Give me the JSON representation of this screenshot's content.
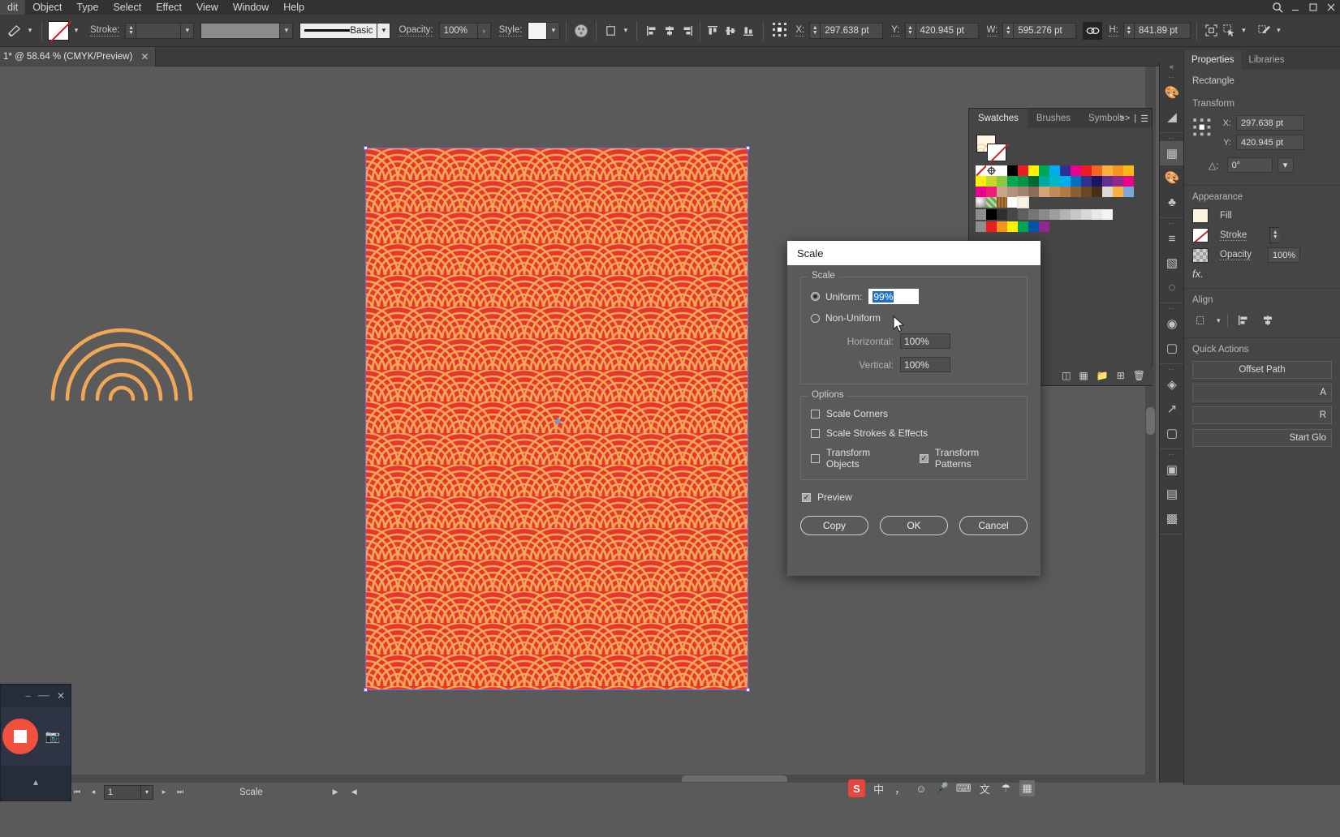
{
  "menubar": {
    "items": [
      "dit",
      "Object",
      "Type",
      "Select",
      "Effect",
      "View",
      "Window",
      "Help"
    ],
    "search_icon": "search-icon",
    "right_icons": [
      "minimize-icon",
      "maximize-icon",
      "close-icon"
    ]
  },
  "controlbar": {
    "tool_icon": "shape-tool-icon",
    "fill_swatch_icon": "no-fill-swatch",
    "stroke_label": "Stroke:",
    "stroke_weight_value": "",
    "stroke_profile_value": "",
    "brush_label_value": "Basic",
    "opacity_label": "Opacity:",
    "opacity_value": "100%",
    "style_label": "Style:",
    "style_swatch": "graphic-style-swatch",
    "recolor_icon": "recolor-artwork-icon",
    "artboard_icon": "artboard-tool-icon",
    "align_icons": [
      "align-left-icon",
      "align-center-h-icon",
      "align-right-icon",
      "align-top-icon",
      "align-middle-v-icon",
      "align-bottom-icon"
    ],
    "reference_point_icon": "reference-point-selector",
    "x_label": "X:",
    "x_value": "297.638 pt",
    "y_label": "Y:",
    "y_value": "420.945 pt",
    "w_label": "W:",
    "w_value": "595.276 pt",
    "link_icon": "constrain-proportions-link",
    "h_label": "H:",
    "h_value": "841.89 pt",
    "transform_icons": [
      "shape-transform-icon",
      "select-similar-icon",
      "isolate-icon"
    ]
  },
  "document_tab": {
    "title": "1* @ 58.64 % (CMYK/Preview)",
    "close_icon": "close-tab-icon"
  },
  "statusbar": {
    "first_icon": "first-page-icon",
    "prev_icon": "previous-page-icon",
    "page_value": "1",
    "page_arrow_icon": "chevron-down-icon",
    "next_icon": "next-page-icon",
    "last_icon": "last-page-icon",
    "tool_name": "Scale",
    "play_icon": "play-arrow-icon",
    "back_icon": "back-arrow-icon"
  },
  "swatches_panel": {
    "tabs": [
      "Swatches",
      "Brushes",
      "Symbols"
    ],
    "active_tab": "Swatches",
    "expand_icon": ">>",
    "divider": "|",
    "menu_icon": "panel-menu-icon",
    "view_list_icon": "list-view-icon",
    "view_grid_icon": "grid-view-icon",
    "fill_swatch": "pattern-fill-swatch",
    "stroke_swatch": "no-stroke-swatch",
    "rows": [
      [
        "none",
        "registration",
        "#ffffff",
        "#000000",
        "#ed1c24",
        "#fff200",
        "#00a651",
        "#00aeef",
        "#2e3192",
        "#ec008c",
        "#ed1c24",
        "#f26522"
      ],
      [
        "#fff200",
        "#c4d82e",
        "#8dc63f",
        "#00a651",
        "#009444",
        "#006838",
        "#00a99d",
        "#00aeef",
        "#0072bc",
        "#2e3192",
        "#1b1464",
        "#662d91"
      ],
      [
        "#ec008c",
        "#ed1e79",
        "#c8a48a",
        "#b5907a",
        "#a3836e",
        "#8c6e57",
        "#d4a373",
        "#c48b5a",
        "#b07a43",
        "#8a5f34",
        "#6b4723",
        "#4a2f17"
      ],
      [
        "globe",
        "#7ab648",
        "#8b5a2b",
        "#ffffff",
        "pattern-selected",
        "",
        "",
        "",
        "",
        "",
        "",
        ""
      ],
      [
        "folder",
        "#000000",
        "#3a3a3a",
        "#4d4d4d",
        "#616161",
        "#757575",
        "#8a8a8a",
        "#9e9e9e",
        "#b3b3b3",
        "#c7c7c7",
        "#dcdcdc",
        "#f0f0f0"
      ],
      [
        "folder",
        "#ed1c24",
        "#f7941e",
        "#fff200",
        "#00a651",
        "#0054a6",
        "#92278f",
        "",
        "",
        "",
        "",
        ""
      ]
    ],
    "bottom_icons": [
      "swatch-libraries-icon",
      "show-swatch-kinds-icon",
      "new-color-group-icon",
      "new-swatch-icon",
      "delete-swatch-icon"
    ]
  },
  "icon_rail": {
    "collapse_icon": "collapse-panels-icon",
    "groups": [
      [
        "color-panel-icon",
        "color-guide-icon"
      ],
      [
        "properties-panel-icon",
        "brushes-panel-icon",
        "symbols-panel-icon"
      ],
      [
        "align-panel-icon",
        "gradient-panel-icon",
        "transparency-panel-icon"
      ],
      [
        "appearance-panel-icon",
        "pathfinder-panel-icon"
      ],
      [
        "layers-panel-icon",
        "asset-export-icon",
        "artboards-panel-icon"
      ],
      [
        "transform-panel-icon",
        "align-panel2-icon",
        "pathfinder2-icon"
      ]
    ]
  },
  "properties_panel": {
    "tabs": [
      "Properties",
      "Libraries"
    ],
    "active_tab": "Properties",
    "object_type": "Rectangle",
    "transform": {
      "heading": "Transform",
      "reference_point_icon": "reference-point-selector",
      "x_label": "X:",
      "x_value": "297.638 pt",
      "y_label": "Y:",
      "y_value": "420.945 pt",
      "angle_icon": "shear-angle-icon",
      "angle_value": "0°",
      "angle_arrow_icon": "chevron-down-icon"
    },
    "appearance": {
      "heading": "Appearance",
      "fill_label": "Fill",
      "fill_swatch_icon": "pattern-fill-swatch",
      "stroke_label": "Stroke",
      "stroke_swatch_icon": "no-stroke-swatch",
      "stroke_value": "",
      "opacity_label": "Opacity",
      "opacity_swatch_icon": "transparency-grid-icon",
      "opacity_value": "100%",
      "fx_label": "fx."
    },
    "align": {
      "heading": "Align",
      "align_to_icon": "align-to-selection-icon",
      "icons": [
        "align-left-icon",
        "align-center-h-icon"
      ]
    },
    "quick_actions": {
      "heading": "Quick Actions",
      "buttons": [
        "Offset Path",
        "A",
        "R",
        "Start Glo"
      ]
    }
  },
  "scale_dialog": {
    "title": "Scale",
    "scale_group_label": "Scale",
    "uniform_label": "Uniform:",
    "uniform_value": "99%",
    "uniform_selected": true,
    "non_uniform_label": "Non-Uniform",
    "horizontal_label": "Horizontal:",
    "horizontal_value": "100%",
    "vertical_label": "Vertical:",
    "vertical_value": "100%",
    "options_group_label": "Options",
    "options": [
      {
        "label": "Scale Corners",
        "checked": false
      },
      {
        "label": "Scale Strokes & Effects",
        "checked": false
      },
      {
        "label": "Transform Objects",
        "checked": false
      },
      {
        "label": "Transform Patterns",
        "checked": true
      }
    ],
    "preview_label": "Preview",
    "preview_checked": true,
    "buttons": [
      "Copy",
      "OK",
      "Cancel"
    ],
    "cursor_icon": "mouse-pointer-cursor"
  },
  "recorder": {
    "minimize_icon": "minimize-icon",
    "restore_icon": "restore-icon",
    "close_icon": "close-icon",
    "record_button_icon": "stop-recording-button",
    "screenshot_icon": "camera-icon",
    "expand_icon": "chevron-up-icon"
  },
  "tray": {
    "ime_icon": "sogou-ime-icon",
    "icons": [
      "chinese-mode-icon",
      "punctuation-icon",
      "emoji-icon",
      "voice-input-icon",
      "keyboard-icon",
      "translate-icon",
      "toolbox-icon",
      "apps-icon"
    ],
    "labels": [
      "中",
      "，",
      "☺",
      "🎤",
      "⌨",
      "文",
      "☂",
      "▦"
    ]
  },
  "canvas": {
    "artboard_fill": "#e8362e",
    "pattern_stroke": "#f0a857",
    "wifi_icon": "wifi-arcs-artwork",
    "anchor_icon": "center-anchor-point"
  }
}
